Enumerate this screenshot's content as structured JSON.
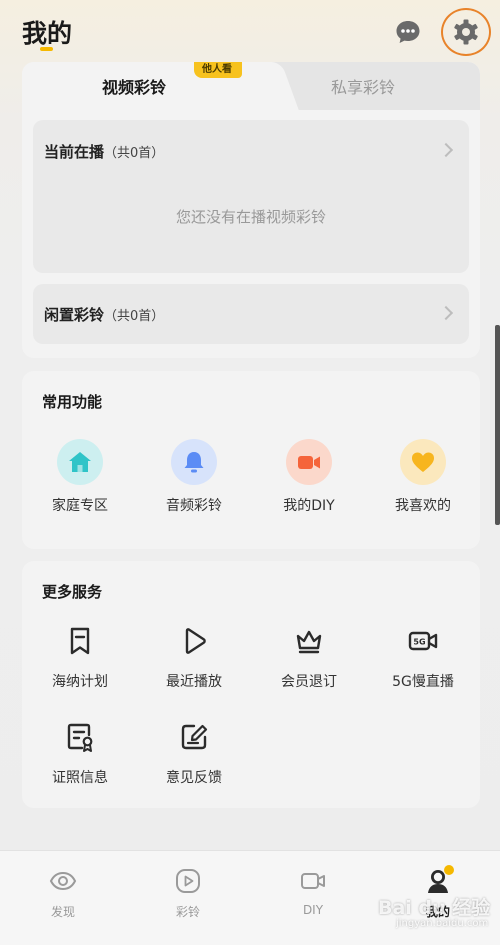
{
  "header": {
    "title": "我的"
  },
  "ringtone_card": {
    "tabs": [
      {
        "label": "视频彩铃",
        "active": true
      },
      {
        "label": "私享彩铃",
        "active": false
      }
    ],
    "badge": "他人看",
    "playing": {
      "title": "当前在播",
      "count": "（共0首）",
      "empty_text": "您还没有在播视频彩铃"
    },
    "idle": {
      "title": "闲置彩铃",
      "count": "（共0首）"
    }
  },
  "common_functions": {
    "title": "常用功能",
    "items": [
      {
        "label": "家庭专区",
        "icon": "home-icon",
        "color": "#2fc4c8"
      },
      {
        "label": "音频彩铃",
        "icon": "bell-icon",
        "color": "#5b8cf5"
      },
      {
        "label": "我的DIY",
        "icon": "video-camera-icon",
        "color": "#f5643a"
      },
      {
        "label": "我喜欢的",
        "icon": "heart-icon",
        "color": "#f7b51e"
      }
    ]
  },
  "more_services": {
    "title": "更多服务",
    "items": [
      {
        "label": "海纳计划",
        "icon": "bookmark-icon"
      },
      {
        "label": "最近播放",
        "icon": "play-icon"
      },
      {
        "label": "会员退订",
        "icon": "crown-icon"
      },
      {
        "label": "5G慢直播",
        "icon": "5g-camera-icon"
      },
      {
        "label": "证照信息",
        "icon": "certificate-icon"
      },
      {
        "label": "意见反馈",
        "icon": "edit-icon"
      }
    ]
  },
  "bottom_nav": {
    "items": [
      {
        "label": "发现",
        "icon": "eye-icon",
        "active": false
      },
      {
        "label": "彩铃",
        "icon": "play-circle-icon",
        "active": false
      },
      {
        "label": "DIY",
        "icon": "diy-camera-icon",
        "active": false
      },
      {
        "label": "我的",
        "icon": "profile-icon",
        "active": true
      }
    ]
  },
  "watermark": {
    "text": "Bai du 经验",
    "sub": "jingyan.baidu.com"
  },
  "colors": {
    "accent": "#f5b800",
    "highlight_ring": "#e8832a"
  }
}
